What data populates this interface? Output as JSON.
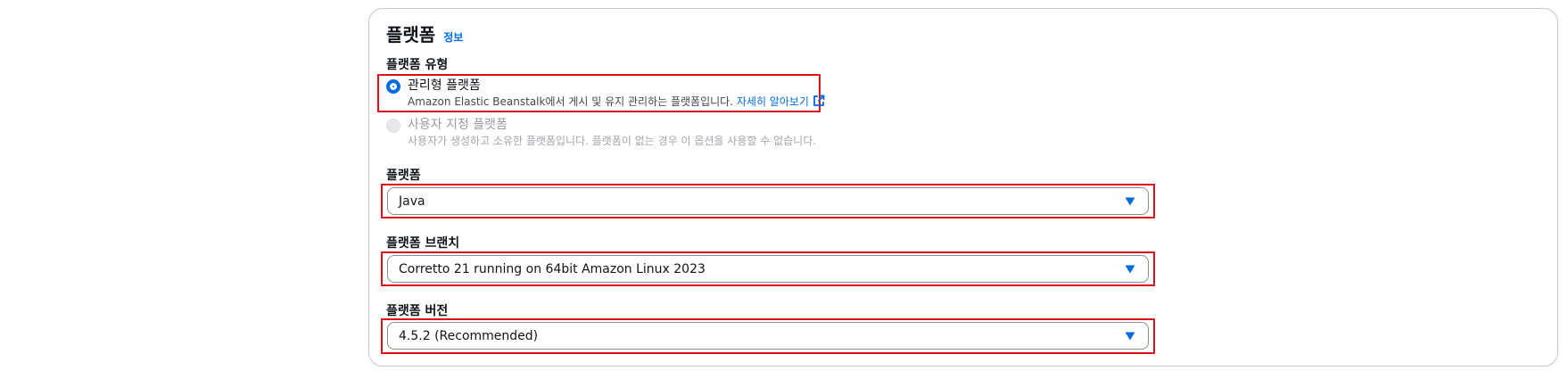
{
  "section": {
    "title": "플랫폼",
    "info_link": "정보"
  },
  "platform_type": {
    "label": "플랫폼 유형",
    "options": [
      {
        "label": "관리형 플랫폼",
        "description": "Amazon Elastic Beanstalk에서 게시 및 유지 관리하는 플랫폼입니다.",
        "link_text": "자세히 알아보기",
        "selected": true,
        "disabled": false
      },
      {
        "label": "사용자 지정 플랫폼",
        "description": "사용자가 생성하고 소유한 플랫폼입니다. 플랫폼이 없는 경우 이 옵션을 사용할 수 없습니다.",
        "selected": false,
        "disabled": true
      }
    ]
  },
  "platform": {
    "label": "플랫폼",
    "value": "Java"
  },
  "platform_branch": {
    "label": "플랫폼 브랜치",
    "value": "Corretto 21 running on 64bit Amazon Linux 2023"
  },
  "platform_version": {
    "label": "플랫폼 버전",
    "value": "4.5.2 (Recommended)"
  },
  "colors": {
    "accent": "#006ce0",
    "highlight": "#e0101b",
    "border": "#8c8c94"
  },
  "icons": [
    "external-link-icon",
    "caret-down-icon"
  ]
}
